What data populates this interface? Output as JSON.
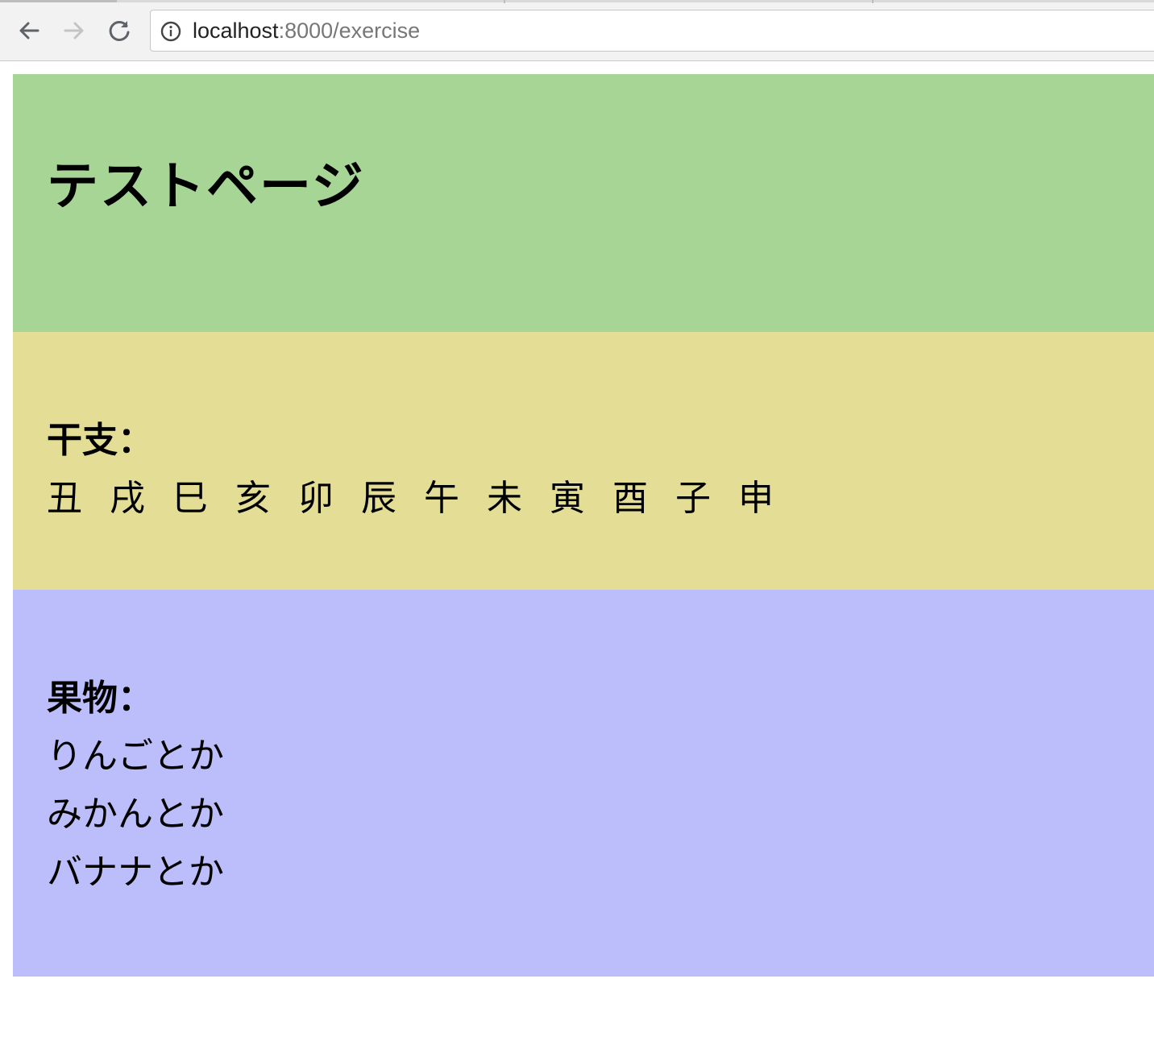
{
  "browser": {
    "url_host": "localhost",
    "url_path": ":8000/exercise"
  },
  "page": {
    "title": "テストページ",
    "zodiac": {
      "label": "干支：",
      "items": [
        "丑",
        "戌",
        "巳",
        "亥",
        "卯",
        "辰",
        "午",
        "未",
        "寅",
        "酉",
        "子",
        "申"
      ]
    },
    "fruits": {
      "label": "果物：",
      "items": [
        "りんごとか",
        "みかんとか",
        "バナナとか"
      ]
    }
  },
  "colors": {
    "header_bg": "#a6d596",
    "zodiac_bg": "#e3dd95",
    "fruit_bg": "#bcbdfb"
  }
}
